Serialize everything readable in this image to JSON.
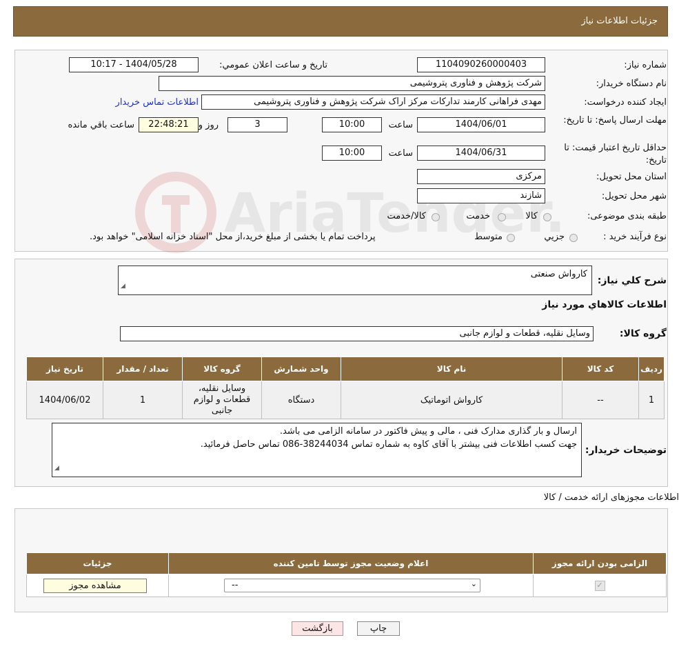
{
  "header": {
    "title": "جزئیات اطلاعات نیاز"
  },
  "form": {
    "need_number": {
      "label": "شماره نیاز:",
      "value": "1104090260000403"
    },
    "announce": {
      "label": "تاریخ و ساعت اعلان عمومي:",
      "value": "1404/05/28 - 10:17"
    },
    "buyer_org": {
      "label": "نام دستگاه خریدار:",
      "value": "شرکت پژوهش و فناوری پتروشیمی"
    },
    "requester": {
      "label": "ایجاد کننده درخواست:",
      "value": "مهدی فراهانی کارمند تدارکات مرکز اراک شرکت پژوهش و فناوری پتروشیمی",
      "contact_link": "اطلاعات تماس خریدار"
    },
    "deadline": {
      "label": "مهلت ارسال پاسخ: تا تاریخ:",
      "date": "1404/06/01",
      "time_label": "ساعت",
      "time": "10:00",
      "days": "3",
      "days_label": "روز و",
      "remaining": "22:48:21",
      "remaining_label": "ساعت باقي مانده"
    },
    "validity": {
      "label": "حداقل تاریخ اعتبار قیمت: تا تاریخ:",
      "date": "1404/06/31",
      "time_label": "ساعت",
      "time": "10:00"
    },
    "province": {
      "label": "استان محل تحویل:",
      "value": "مرکزی"
    },
    "city": {
      "label": "شهر محل تحویل:",
      "value": "شازند"
    },
    "category": {
      "label": "طبقه بندی موضوعی:",
      "options": [
        "کالا",
        "خدمت",
        "کالا/خدمت"
      ]
    },
    "process": {
      "label": "نوع فرآیند خرید :",
      "options": [
        "جزیي",
        "متوسط"
      ],
      "note": "پرداخت تمام یا بخشی از مبلغ خرید،از محل \"اسناد خزانه اسلامی\" خواهد بود."
    }
  },
  "summary": {
    "label": "شرح كلي نياز:",
    "value": "کارواش صنعتی"
  },
  "goods_title": "اطلاعات كالاهاي مورد نياز",
  "goods_group": {
    "label": "گروه كالا:",
    "value": "وسایل نقلیه، قطعات و لوازم جانبی"
  },
  "goods_table": {
    "headers": [
      "ردیف",
      "کد کالا",
      "نام کالا",
      "واحد شمارش",
      "گروه کالا",
      "تعداد / مقدار",
      "تاریخ نیاز"
    ],
    "rows": [
      [
        "1",
        "--",
        "کارواش اتوماتیک",
        "دستگاه",
        "وسایل نقلیه، قطعات و لوازم جانبی",
        "1",
        "1404/06/02"
      ]
    ]
  },
  "buyer_notes": {
    "label": "توضیحات خریدار:",
    "line1": "ارسال و بار گذاری مدارک فنی ، مالی و پیش فاکتور در سامانه الزامی می باشد.",
    "line2": "جهت کسب اطلاعات فنی بیشتر با آقای کاوه به شماره تماس 38244034-086 تماس حاصل فرمائید."
  },
  "license": {
    "title": "اطلاعات مجوزهای ارائه خدمت / کالا",
    "headers": [
      "الزامی بودن ارائه مجوز",
      "اعلام وضعیت مجوز توسط تامین کننده",
      "جزئیات"
    ],
    "select_value": "--",
    "view_button": "مشاهده مجوز"
  },
  "buttons": {
    "print": "چاپ",
    "back": "بازگشت"
  },
  "watermark": "AriaTender.neT"
}
